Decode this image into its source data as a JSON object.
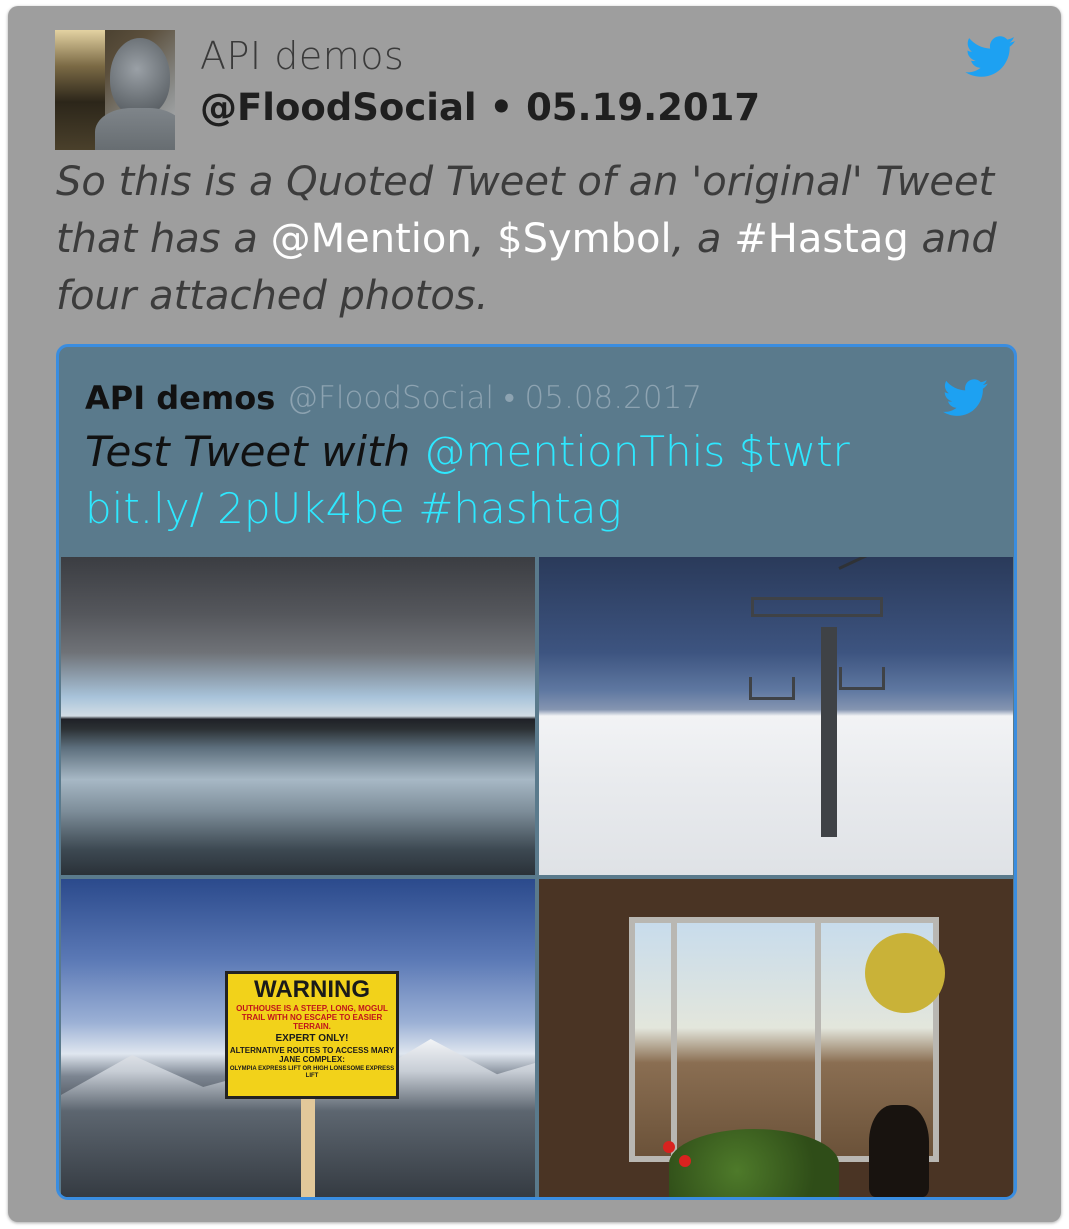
{
  "tweet": {
    "author_name": "API demos",
    "handle": "@FloodSocial",
    "separator": "•",
    "date": "05.19.2017",
    "text_parts": {
      "t1": "So this is a Quoted Tweet of an 'original' Tweet that has a ",
      "mention": "@Mention",
      "t2": ",  ",
      "symbol": "$Symbol",
      "t3": ", a ",
      "hashtag": "#Hastag",
      "t4": " and four attached photos."
    }
  },
  "quoted": {
    "author_name": "API demos",
    "meta": "@FloodSocial • 05.08.2017",
    "text_parts": {
      "t1": "Test Tweet with ",
      "entities": "@mentionThis $twtr bit.ly/ 2pUk4be #hashtag"
    },
    "photos": [
      {
        "icon": "lake-storm-clouds-photo"
      },
      {
        "icon": "ski-lift-photo"
      },
      {
        "icon": "warning-sign-photo"
      },
      {
        "icon": "window-cat-photo"
      }
    ],
    "sign": {
      "title": "WARNING",
      "line1": "OUTHOUSE IS A STEEP, LONG, MOGUL TRAIL WITH NO ESCAPE TO EASIER TERRAIN.",
      "line2": "EXPERT ONLY!",
      "line3": "ALTERNATIVE ROUTES TO ACCESS MARY JANE COMPLEX:",
      "line4": "OLYMPIA EXPRESS LIFT OR HIGH LONESOME EXPRESS LIFT"
    }
  },
  "colors": {
    "card_bg": "#9e9e9e",
    "quote_bg": "#5a7a8c",
    "quote_border": "#3a8de0",
    "twitter_blue": "#1da1f2",
    "entity_cyan": "#2ee8ff"
  }
}
